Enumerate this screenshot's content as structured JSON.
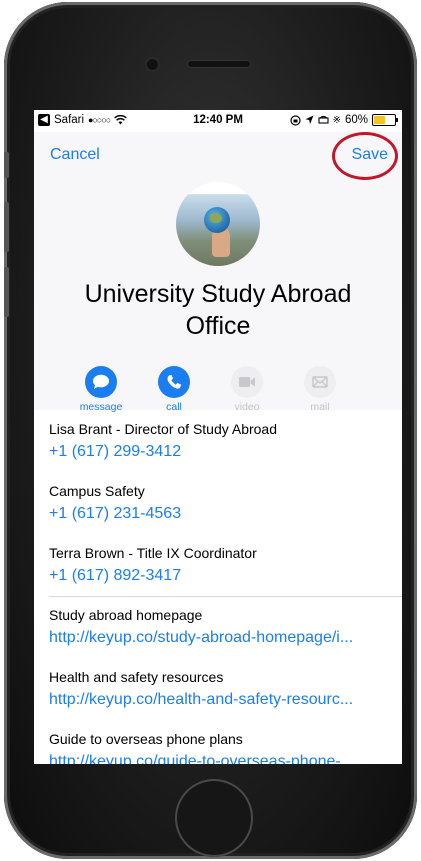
{
  "status_bar": {
    "back_app": "Safari",
    "signal": "●○○○○",
    "time": "12:40 PM",
    "battery": "60%",
    "battery_fraction": 0.6
  },
  "nav": {
    "cancel_label": "Cancel",
    "save_label": "Save"
  },
  "contact": {
    "name_line1": "University Study Abroad",
    "name_line2": "Office"
  },
  "actions": [
    {
      "label": "message",
      "enabled": true
    },
    {
      "label": "call",
      "enabled": true
    },
    {
      "label": "video",
      "enabled": false
    },
    {
      "label": "mail",
      "enabled": false
    }
  ],
  "phones": [
    {
      "label": "Lisa Brant - Director of Study Abroad",
      "value": "+1 (617) 299-3412"
    },
    {
      "label": "Campus Safety",
      "value": "+1 (617) 231-4563"
    },
    {
      "label": "Terra Brown - Title IX Coordinator",
      "value": "+1 (617) 892-3417"
    }
  ],
  "urls": [
    {
      "label": "Study abroad homepage",
      "value": "http://keyup.co/study-abroad-homepage/i..."
    },
    {
      "label": "Health and safety resources",
      "value": "http://keyup.co/health-and-safety-resourc..."
    },
    {
      "label": "Guide to overseas phone plans",
      "value": "http://keyup.co/guide-to-overseas-phone-"
    }
  ],
  "colors": {
    "accent": "#1a7ef0",
    "highlight_ring": "#c0182a"
  }
}
